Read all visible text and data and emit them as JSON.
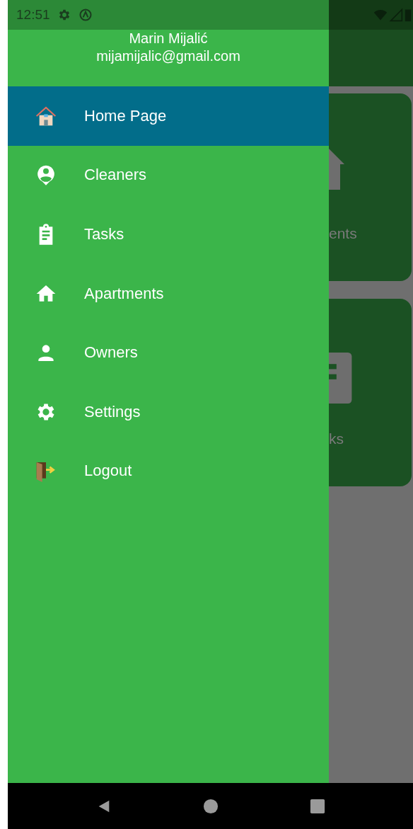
{
  "status_bar": {
    "time": "12:51"
  },
  "drawer": {
    "header": {
      "name": "Marin Mijalić",
      "email": "mijamijalic@gmail.com"
    },
    "items": [
      {
        "label": "Home Page",
        "kind": "home",
        "selected": true
      },
      {
        "label": "Cleaners",
        "kind": "cleaners",
        "selected": false
      },
      {
        "label": "Tasks",
        "kind": "tasks",
        "selected": false
      },
      {
        "label": "Apartments",
        "kind": "apartments",
        "selected": false
      },
      {
        "label": "Owners",
        "kind": "owners",
        "selected": false
      },
      {
        "label": "Settings",
        "kind": "settings",
        "selected": false
      },
      {
        "label": "Logout",
        "kind": "logout",
        "selected": false
      }
    ]
  },
  "background": {
    "cards": [
      {
        "label": "ents",
        "kind": "apartments"
      },
      {
        "label": "ks",
        "kind": "tasks"
      }
    ]
  }
}
